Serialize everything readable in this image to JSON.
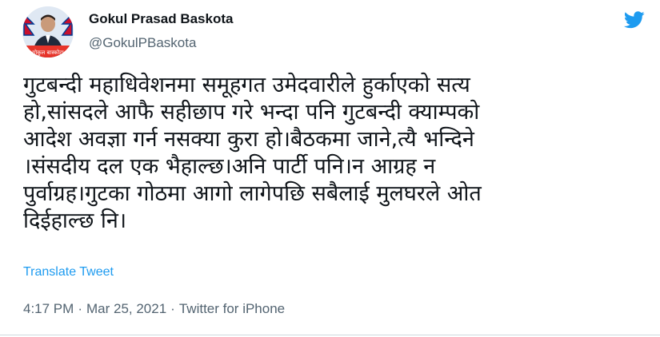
{
  "author": {
    "name": "Gokul Prasad Baskota",
    "handle": "@GokulPBaskota",
    "avatar_caption": "गोकुल बास्कोटा"
  },
  "tweet": {
    "lines": [
      "गुटबन्दी महाधिवेशनमा समूहगत उमेदवारीले हुर्काएको सत्य",
      "हो,सांसदले आफै सहीछाप गरे भन्दा पनि गुटबन्दी क्याम्पको",
      "आदेश अवज्ञा गर्न नसक्या कुरा हो।बैठकमा जाने,त्यै भन्दिने",
      "।संसदीय दल एक भैहाल्छ।अनि पार्टी पनि।न आग्रह न",
      "पुर्वाग्रह।गुटका गोठमा आगो लागेपछि सबैलाई मुलघरले ओत",
      "दिईहाल्छ नि।"
    ],
    "translate_label": "Translate Tweet",
    "time": "4:17 PM",
    "separator": "·",
    "date": "Mar 25, 2021",
    "source": "Twitter for iPhone"
  },
  "icons": {
    "brand": "twitter-bird-icon"
  },
  "colors": {
    "brand_blue": "#1d9bf0",
    "text_primary": "#0f1419",
    "text_secondary": "#536471"
  }
}
